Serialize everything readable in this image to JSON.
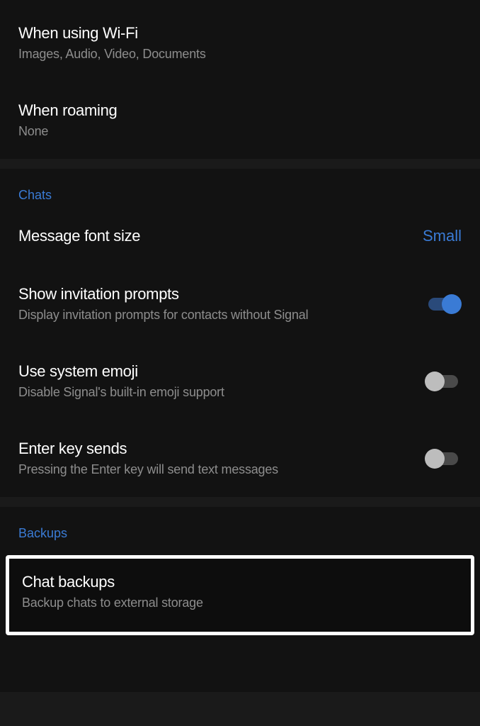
{
  "media": {
    "wifi": {
      "title": "When using Wi-Fi",
      "subtitle": "Images, Audio, Video, Documents"
    },
    "roaming": {
      "title": "When roaming",
      "subtitle": "None"
    }
  },
  "chats": {
    "header": "Chats",
    "font_size": {
      "title": "Message font size",
      "value": "Small"
    },
    "invitation": {
      "title": "Show invitation prompts",
      "subtitle": "Display invitation prompts for contacts without Signal",
      "enabled": true
    },
    "system_emoji": {
      "title": "Use system emoji",
      "subtitle": "Disable Signal's built-in emoji support",
      "enabled": false
    },
    "enter_sends": {
      "title": "Enter key sends",
      "subtitle": "Pressing the Enter key will send text messages",
      "enabled": false
    }
  },
  "backups": {
    "header": "Backups",
    "chat_backups": {
      "title": "Chat backups",
      "subtitle": "Backup chats to external storage"
    }
  }
}
